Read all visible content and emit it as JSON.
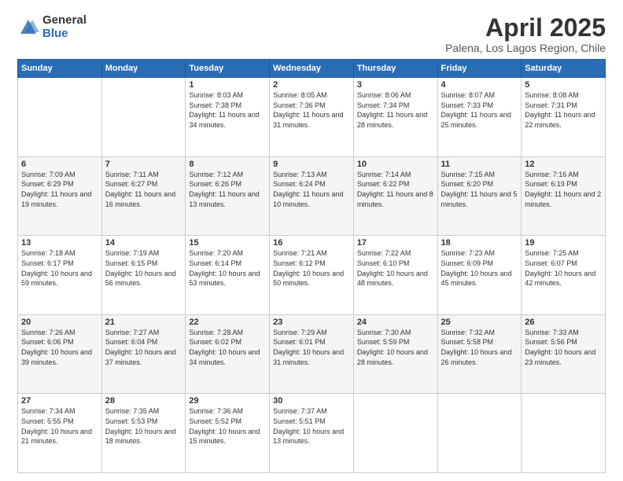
{
  "logo": {
    "general": "General",
    "blue": "Blue"
  },
  "title": {
    "month": "April 2025",
    "location": "Palena, Los Lagos Region, Chile"
  },
  "header": {
    "days": [
      "Sunday",
      "Monday",
      "Tuesday",
      "Wednesday",
      "Thursday",
      "Friday",
      "Saturday"
    ]
  },
  "weeks": [
    [
      {
        "num": "",
        "info": ""
      },
      {
        "num": "",
        "info": ""
      },
      {
        "num": "1",
        "info": "Sunrise: 8:03 AM\nSunset: 7:38 PM\nDaylight: 11 hours and 34 minutes."
      },
      {
        "num": "2",
        "info": "Sunrise: 8:05 AM\nSunset: 7:36 PM\nDaylight: 11 hours and 31 minutes."
      },
      {
        "num": "3",
        "info": "Sunrise: 8:06 AM\nSunset: 7:34 PM\nDaylight: 11 hours and 28 minutes."
      },
      {
        "num": "4",
        "info": "Sunrise: 8:07 AM\nSunset: 7:33 PM\nDaylight: 11 hours and 25 minutes."
      },
      {
        "num": "5",
        "info": "Sunrise: 8:08 AM\nSunset: 7:31 PM\nDaylight: 11 hours and 22 minutes."
      }
    ],
    [
      {
        "num": "6",
        "info": "Sunrise: 7:09 AM\nSunset: 6:29 PM\nDaylight: 11 hours and 19 minutes."
      },
      {
        "num": "7",
        "info": "Sunrise: 7:11 AM\nSunset: 6:27 PM\nDaylight: 11 hours and 16 minutes."
      },
      {
        "num": "8",
        "info": "Sunrise: 7:12 AM\nSunset: 6:26 PM\nDaylight: 11 hours and 13 minutes."
      },
      {
        "num": "9",
        "info": "Sunrise: 7:13 AM\nSunset: 6:24 PM\nDaylight: 11 hours and 10 minutes."
      },
      {
        "num": "10",
        "info": "Sunrise: 7:14 AM\nSunset: 6:22 PM\nDaylight: 11 hours and 8 minutes."
      },
      {
        "num": "11",
        "info": "Sunrise: 7:15 AM\nSunset: 6:20 PM\nDaylight: 11 hours and 5 minutes."
      },
      {
        "num": "12",
        "info": "Sunrise: 7:16 AM\nSunset: 6:19 PM\nDaylight: 11 hours and 2 minutes."
      }
    ],
    [
      {
        "num": "13",
        "info": "Sunrise: 7:18 AM\nSunset: 6:17 PM\nDaylight: 10 hours and 59 minutes."
      },
      {
        "num": "14",
        "info": "Sunrise: 7:19 AM\nSunset: 6:15 PM\nDaylight: 10 hours and 56 minutes."
      },
      {
        "num": "15",
        "info": "Sunrise: 7:20 AM\nSunset: 6:14 PM\nDaylight: 10 hours and 53 minutes."
      },
      {
        "num": "16",
        "info": "Sunrise: 7:21 AM\nSunset: 6:12 PM\nDaylight: 10 hours and 50 minutes."
      },
      {
        "num": "17",
        "info": "Sunrise: 7:22 AM\nSunset: 6:10 PM\nDaylight: 10 hours and 48 minutes."
      },
      {
        "num": "18",
        "info": "Sunrise: 7:23 AM\nSunset: 6:09 PM\nDaylight: 10 hours and 45 minutes."
      },
      {
        "num": "19",
        "info": "Sunrise: 7:25 AM\nSunset: 6:07 PM\nDaylight: 10 hours and 42 minutes."
      }
    ],
    [
      {
        "num": "20",
        "info": "Sunrise: 7:26 AM\nSunset: 6:06 PM\nDaylight: 10 hours and 39 minutes."
      },
      {
        "num": "21",
        "info": "Sunrise: 7:27 AM\nSunset: 6:04 PM\nDaylight: 10 hours and 37 minutes."
      },
      {
        "num": "22",
        "info": "Sunrise: 7:28 AM\nSunset: 6:02 PM\nDaylight: 10 hours and 34 minutes."
      },
      {
        "num": "23",
        "info": "Sunrise: 7:29 AM\nSunset: 6:01 PM\nDaylight: 10 hours and 31 minutes."
      },
      {
        "num": "24",
        "info": "Sunrise: 7:30 AM\nSunset: 5:59 PM\nDaylight: 10 hours and 28 minutes."
      },
      {
        "num": "25",
        "info": "Sunrise: 7:32 AM\nSunset: 5:58 PM\nDaylight: 10 hours and 26 minutes."
      },
      {
        "num": "26",
        "info": "Sunrise: 7:33 AM\nSunset: 5:56 PM\nDaylight: 10 hours and 23 minutes."
      }
    ],
    [
      {
        "num": "27",
        "info": "Sunrise: 7:34 AM\nSunset: 5:55 PM\nDaylight: 10 hours and 21 minutes."
      },
      {
        "num": "28",
        "info": "Sunrise: 7:35 AM\nSunset: 5:53 PM\nDaylight: 10 hours and 18 minutes."
      },
      {
        "num": "29",
        "info": "Sunrise: 7:36 AM\nSunset: 5:52 PM\nDaylight: 10 hours and 15 minutes."
      },
      {
        "num": "30",
        "info": "Sunrise: 7:37 AM\nSunset: 5:51 PM\nDaylight: 10 hours and 13 minutes."
      },
      {
        "num": "",
        "info": ""
      },
      {
        "num": "",
        "info": ""
      },
      {
        "num": "",
        "info": ""
      }
    ]
  ]
}
